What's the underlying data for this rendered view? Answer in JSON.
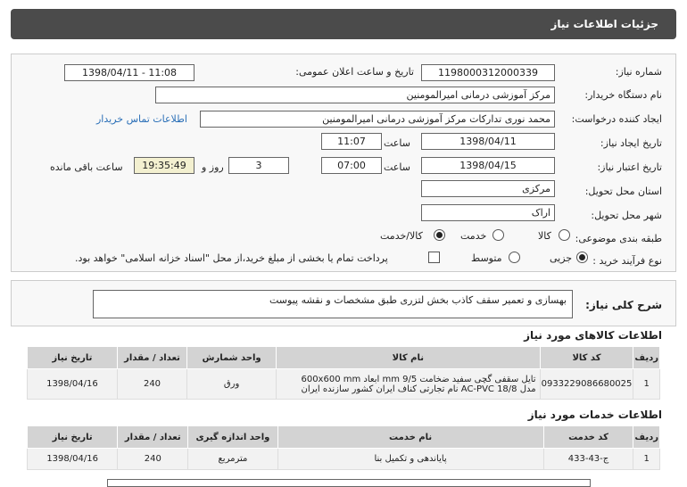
{
  "header": {
    "title": "جزئیات اطلاعات نیاز"
  },
  "form": {
    "need_number_label": "شماره نیاز:",
    "need_number": "1198000312000339",
    "announce_label": "تاریخ و ساعت اعلان عمومی:",
    "announce_value": "1398/04/11 - 11:08",
    "buyer_label": "نام دستگاه خریدار:",
    "buyer": "مرکز آموزشی درمانی امیرالمومنین",
    "creator_label": "ایجاد کننده درخواست:",
    "creator": "محمد نوری تدارکات مرکز آموزشی درمانی امیرالمومنین",
    "contact_link": "اطلاعات تماس خریدار",
    "created_date_label": "تاریخ ایجاد نیاز:",
    "created_date": "1398/04/11",
    "time_label": "ساعت",
    "created_time": "11:07",
    "valid_date_label": "تاریخ اعتبار نیاز:",
    "valid_date": "1398/04/15",
    "valid_time": "07:00",
    "days": "3",
    "days_label": "روز و",
    "remaining": "19:35:49",
    "remaining_label": "ساعت باقی مانده",
    "province_label": "استان محل تحویل:",
    "province": "مرکزی",
    "city_label": "شهر محل تحویل:",
    "city": "اراک",
    "category_label": "طبقه بندی موضوعی:",
    "cat_goods": "کالا",
    "cat_service": "خدمت",
    "cat_goods_service": "کالا/خدمت",
    "process_label": "نوع فرآیند خرید :",
    "proc_partial": "جزیی",
    "proc_medium": "متوسط",
    "payment_note": "پرداخت تمام یا بخشی از مبلغ خرید،از محل \"اسناد خزانه اسلامی\" خواهد بود."
  },
  "description": {
    "label": "شرح کلی نیاز:",
    "text": "بهسازی و تعمیر سقف کاذب بخش لتزری طبق مشخصات و نقشه پیوست"
  },
  "goods": {
    "title": "اطلاعات کالاهای مورد نیاز",
    "headers": [
      "ردیف",
      "کد کالا",
      "نام کالا",
      "واحد شمارش",
      "تعداد / مقدار",
      "تاریخ نیاز"
    ],
    "rows": [
      {
        "row": "1",
        "code": "0933229086680025",
        "name1": "تایل سقفی گچی سفید ضخامت 9/5 mm ابعاد 600x600 mm",
        "name2": "مدل AC-PVC 18/8 نام تجارتی کناف ایران کشور سازنده ایران",
        "unit": "ورق",
        "qty": "240",
        "date": "1398/04/16"
      }
    ]
  },
  "services": {
    "title": "اطلاعات خدمات مورد نیاز",
    "headers": [
      "ردیف",
      "کد خدمت",
      "نام خدمت",
      "واحد اندازه گیری",
      "تعداد / مقدار",
      "تاریخ نیاز"
    ],
    "rows": [
      {
        "row": "1",
        "code": "ج-43-433",
        "name": "پایاندهی و تکمیل بنا",
        "unit": "مترمربع",
        "qty": "240",
        "date": "1398/04/16"
      }
    ]
  }
}
